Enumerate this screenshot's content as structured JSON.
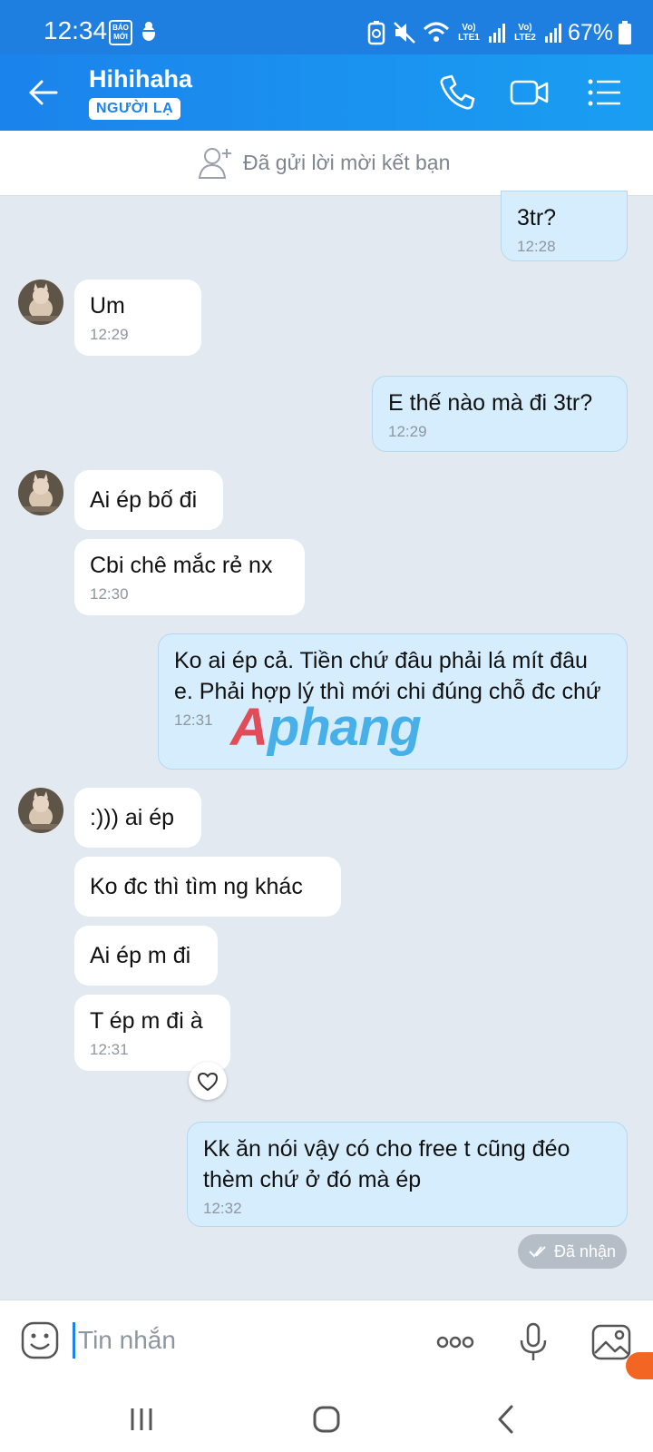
{
  "status_bar": {
    "time": "12:34",
    "news_badge": "BÁO MỚI",
    "sim1": "Vo) LTE1",
    "sim2": "Vo) LTE2",
    "battery": "67%"
  },
  "header": {
    "contact_name": "Hihihaha",
    "badge": "NGƯỜI LẠ",
    "icons": [
      "back-arrow-icon",
      "phone-icon",
      "video-call-icon",
      "menu-list-icon"
    ]
  },
  "friend_request": {
    "text": "Đã gửi lời mời kết bạn"
  },
  "messages": [
    {
      "dir": "out",
      "text": "3tr?",
      "time": "12:28"
    },
    {
      "dir": "in",
      "text": "Um",
      "time": "12:29"
    },
    {
      "dir": "out",
      "text": "E thế nào mà đi 3tr?",
      "time": "12:29"
    },
    {
      "dir": "in",
      "text": "Ai ép bố đi",
      "time": ""
    },
    {
      "dir": "in",
      "text": "Cbi chê mắc rẻ nx",
      "time": "12:30"
    },
    {
      "dir": "out",
      "text": "Ko ai ép cả. Tiền chứ đâu phải lá mít đâu e. Phải hợp lý thì mới chi đúng chỗ đc chứ",
      "time": "12:31"
    },
    {
      "dir": "in",
      "text": ":))) ai ép",
      "time": ""
    },
    {
      "dir": "in",
      "text": "Ko đc thì tìm ng khác",
      "time": ""
    },
    {
      "dir": "in",
      "text": "Ai ép m đi",
      "time": ""
    },
    {
      "dir": "in",
      "text": "T ép m đi à",
      "time": "12:31"
    },
    {
      "dir": "out",
      "text": "Kk ăn nói vậy có cho free t cũng đéo thèm chứ ở đó mà ép",
      "time": "12:32"
    }
  ],
  "received_status": "Đã nhận",
  "watermark": {
    "first": "A",
    "rest": "phang"
  },
  "input": {
    "placeholder": "Tin nhắn"
  },
  "colors": {
    "header": "#1b83ec",
    "incoming_bubble": "#ffffff",
    "outgoing_bubble": "#d6edfd",
    "background": "#e2e9f1"
  }
}
